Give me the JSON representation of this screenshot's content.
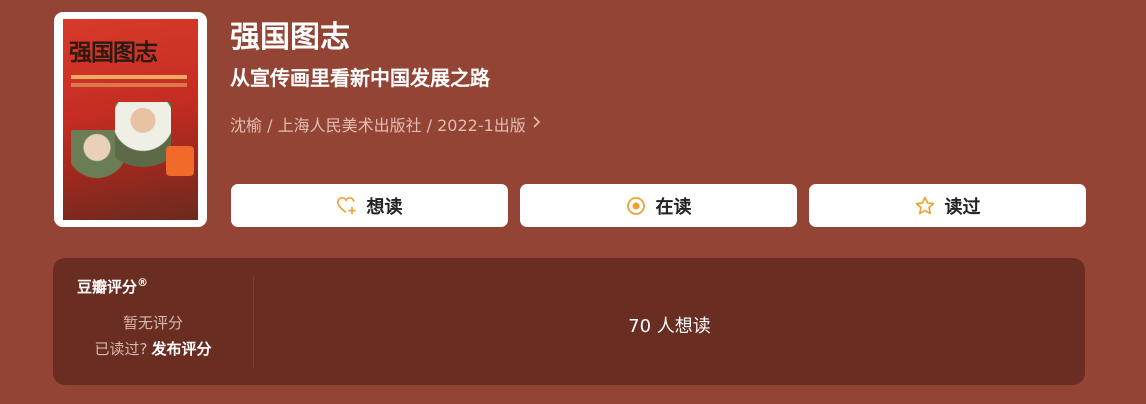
{
  "book": {
    "title": "强国图志",
    "subtitle": "从宣传画里看新中国发展之路",
    "meta": "沈榆 / 上海人民美术出版社 / 2022-1出版",
    "cover_text": "强国图志"
  },
  "actions": {
    "want_label": "想读",
    "reading_label": "在读",
    "read_label": "读过"
  },
  "rating": {
    "title": "豆瓣评分",
    "title_mark": "®",
    "no_rating": "暂无评分",
    "read_prompt": "已读过?",
    "post_rating": "发布评分",
    "want_count_text": "70 人想读"
  },
  "colors": {
    "background": "#944434",
    "panel": "#692d22",
    "accent_orange": "#f0a030"
  },
  "icons": {
    "want": "heart-plus-icon",
    "reading": "target-circle-icon",
    "read": "star-icon",
    "meta": "chevron-right-icon"
  }
}
